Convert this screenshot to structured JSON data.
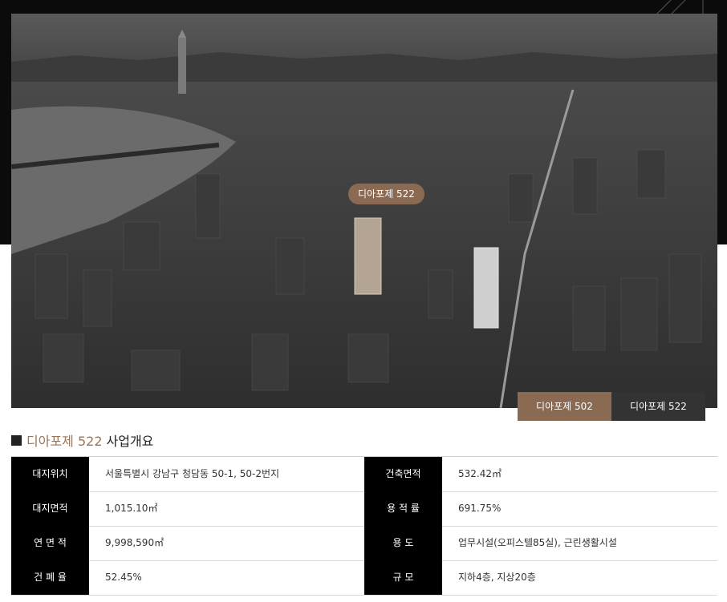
{
  "hero": {
    "map_label": "디아포제 522",
    "tabs": [
      {
        "label": "디아포제 502",
        "active": true
      },
      {
        "label": "디아포제 522",
        "active": false
      }
    ]
  },
  "section": {
    "accent": "디아포제 522",
    "title": "사업개요"
  },
  "overview": {
    "rows": [
      {
        "label_left": "대지위치",
        "value_left": "서울특별시 강남구 청담동 50-1, 50-2번지",
        "label_right": "건축면적",
        "value_right": "532.42㎡"
      },
      {
        "label_left": "대지면적",
        "value_left": "1,015.10㎡",
        "label_right": "용 적 률",
        "value_right": "691.75%"
      },
      {
        "label_left": "연 면 적",
        "value_left": "9,998,590㎡",
        "label_right": "용      도",
        "value_right": "업무시설(오피스텔85실), 근린생활시설"
      },
      {
        "label_left": "건 폐 율",
        "value_left": "52.45%",
        "label_right": "규      모",
        "value_right": "지하4층, 지상20층"
      }
    ]
  },
  "colors": {
    "accent": "#8a6a52",
    "dark_tab": "#333333",
    "label_bg": "#000000"
  }
}
